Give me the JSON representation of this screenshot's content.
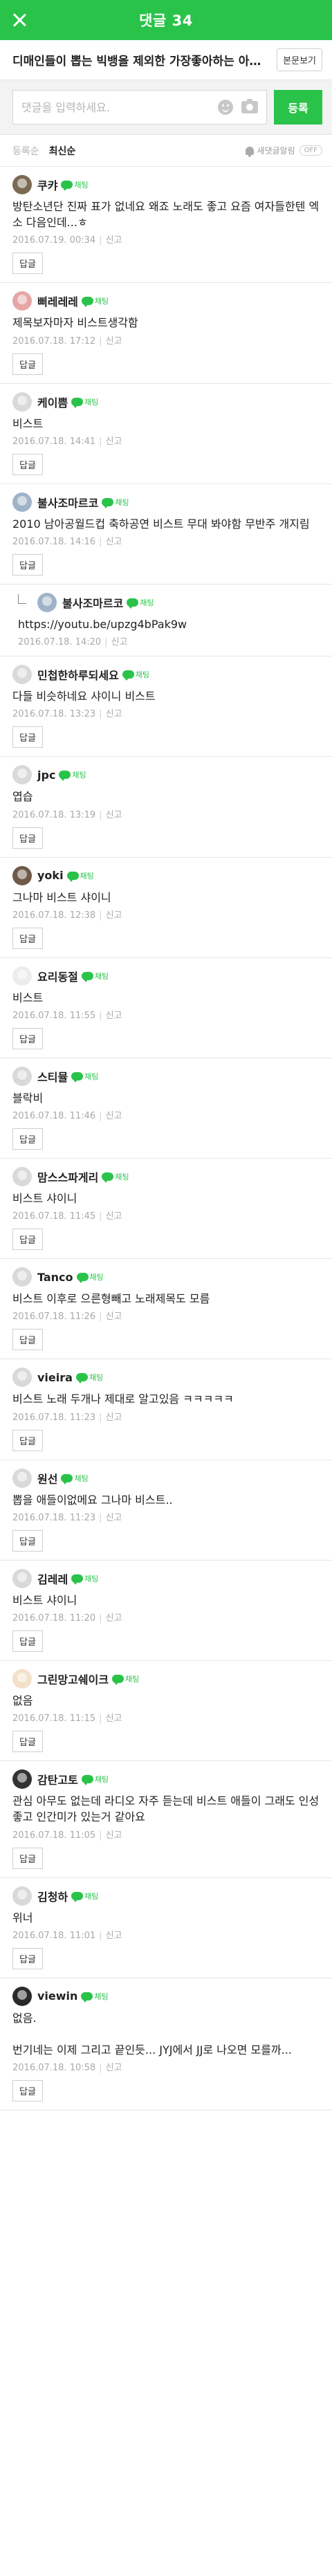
{
  "header": {
    "title": "댓글 34"
  },
  "article": {
    "title": "디매인들이 뽑는 빅뱅을 제외한 가장좋아하는 아이돌 노래",
    "view_label": "본문보기"
  },
  "write": {
    "placeholder": "댓글을 입력하세요.",
    "submit_label": "등록"
  },
  "sort": {
    "registered": "등록순",
    "latest": "최신순",
    "notify_label": "새댓글알림",
    "toggle_label": "OFF"
  },
  "comments": [
    {
      "nick": "쿠캬",
      "badge": "채팅",
      "text": "방탄소년단 진짜 표가 없네요 왜죠 노래도 좋고 요즘 여자들한텐 엑소 다음인데...ㅎ",
      "date": "2016.07.19. 00:34",
      "report": "신고",
      "reply_label": "답글",
      "reply": false,
      "avatar_color": "#7a6a52",
      "has_badge": true
    },
    {
      "nick": "삐레레레",
      "badge": "채팅",
      "text": "제목보자마자 비스트생각함",
      "date": "2016.07.18. 17:12",
      "report": "신고",
      "reply_label": "답글",
      "reply": false,
      "avatar_color": "#e6a6a6",
      "has_badge": true
    },
    {
      "nick": "케이쁨",
      "badge": "채팅",
      "text": "비스트",
      "date": "2016.07.18. 14:41",
      "report": "신고",
      "reply_label": "답글",
      "reply": false,
      "avatar_color": "#d9d9d9",
      "has_badge": true
    },
    {
      "nick": "불사조마르코",
      "badge": "채팅",
      "text": "2010 남아공월드컵 축하공연 비스트 무대 봐야함 무반주 개지림",
      "date": "2016.07.18. 14:16",
      "report": "신고",
      "reply_label": "답글",
      "reply": false,
      "avatar_color": "#9fb3c8",
      "has_badge": true
    },
    {
      "nick": "불사조마르코",
      "badge": "채팅",
      "text": "https://youtu.be/upzg4bPak9w",
      "date": "2016.07.18. 14:20",
      "report": "신고",
      "reply_label": "",
      "reply": true,
      "avatar_color": "#9fb3c8",
      "has_badge": true
    },
    {
      "nick": "민첩한하루되세요",
      "badge": "채팅",
      "text": "다들 비슷하네요 샤이니 비스트",
      "date": "2016.07.18. 13:23",
      "report": "신고",
      "reply_label": "답글",
      "reply": false,
      "avatar_color": "#d9d9d9",
      "has_badge": true
    },
    {
      "nick": "jpc",
      "badge": "채팅",
      "text": "엽습",
      "date": "2016.07.18. 13:19",
      "report": "신고",
      "reply_label": "답글",
      "reply": false,
      "avatar_color": "#d9d9d9",
      "has_badge": true
    },
    {
      "nick": "yoki",
      "badge": "채팅",
      "text": "그나마 비스트 샤이니",
      "date": "2016.07.18. 12:38",
      "report": "신고",
      "reply_label": "답글",
      "reply": false,
      "avatar_color": "#6e5a4a",
      "has_badge": true
    },
    {
      "nick": "요리동절",
      "badge": "채팅",
      "text": "비스트",
      "date": "2016.07.18. 11:55",
      "report": "신고",
      "reply_label": "답글",
      "reply": false,
      "avatar_color": "#ececec",
      "has_badge": true
    },
    {
      "nick": "스티뮬",
      "badge": "채팅",
      "text": "블락비",
      "date": "2016.07.18. 11:46",
      "report": "신고",
      "reply_label": "답글",
      "reply": false,
      "avatar_color": "#d9d9d9",
      "has_badge": true
    },
    {
      "nick": "맘스스파게리",
      "badge": "채팅",
      "text": "비스트 샤이니",
      "date": "2016.07.18. 11:45",
      "report": "신고",
      "reply_label": "답글",
      "reply": false,
      "avatar_color": "#d9d9d9",
      "has_badge": true
    },
    {
      "nick": "Tanco",
      "badge": "채팅",
      "text": "비스트 이후로 으른형빼고 노래제목도 모름",
      "date": "2016.07.18. 11:26",
      "report": "신고",
      "reply_label": "답글",
      "reply": false,
      "avatar_color": "#d9d9d9",
      "has_badge": true
    },
    {
      "nick": "vieira",
      "badge": "채팅",
      "text": "비스트 노래 두개나 제대로 알고있음 ㅋㅋㅋㅋㅋ",
      "date": "2016.07.18. 11:23",
      "report": "신고",
      "reply_label": "답글",
      "reply": false,
      "avatar_color": "#d9d9d9",
      "has_badge": true
    },
    {
      "nick": "원선",
      "badge": "채팅",
      "text": "뽑을 애들이없메요 그나마 비스트..",
      "date": "2016.07.18. 11:23",
      "report": "신고",
      "reply_label": "답글",
      "reply": false,
      "avatar_color": "#d9d9d9",
      "has_badge": true
    },
    {
      "nick": "김레레",
      "badge": "채팅",
      "text": "비스트 샤이니",
      "date": "2016.07.18. 11:20",
      "report": "신고",
      "reply_label": "답글",
      "reply": false,
      "avatar_color": "#d9d9d9",
      "has_badge": true
    },
    {
      "nick": "그린망고쉐이크",
      "badge": "채팅",
      "text": "없음",
      "date": "2016.07.18. 11:15",
      "report": "신고",
      "reply_label": "답글",
      "reply": false,
      "avatar_color": "#f2e0c9",
      "has_badge": true
    },
    {
      "nick": "감탄고토",
      "badge": "채팅",
      "text": "관심 아무도 없는데 라디오 자주 듣는데 비스트 애들이 그래도 인성좋고 인간미가 있는거 같아요",
      "date": "2016.07.18. 11:05",
      "report": "신고",
      "reply_label": "답글",
      "reply": false,
      "avatar_color": "#333333",
      "has_badge": true
    },
    {
      "nick": "김청하",
      "badge": "채팅",
      "text": "위너",
      "date": "2016.07.18. 11:01",
      "report": "신고",
      "reply_label": "답글",
      "reply": false,
      "avatar_color": "#d9d9d9",
      "has_badge": true
    },
    {
      "nick": "viewin",
      "badge": "채팅",
      "text": "없음.\n\n번기네는 이제 그리고 끝인듯... JYJ에서 JJ로 나오면 모를까...",
      "date": "2016.07.18. 10:58",
      "report": "신고",
      "reply_label": "답글",
      "reply": false,
      "avatar_color": "#2a2a2a",
      "has_badge": true
    }
  ]
}
